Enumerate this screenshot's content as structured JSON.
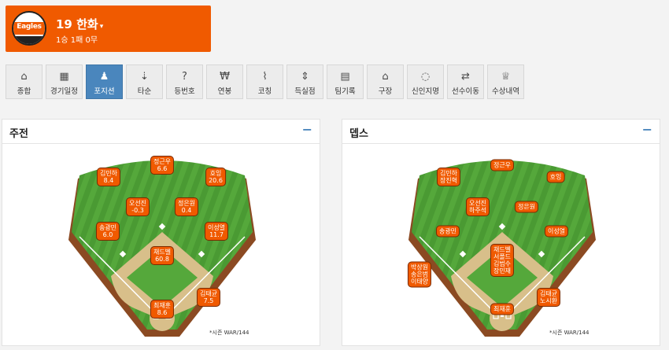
{
  "team": {
    "logo_text": "Eagles",
    "title": "19 한화",
    "record": "1승 1패 0무",
    "colors": {
      "accent": "#f05a00",
      "nav_active": "#4a86bd"
    }
  },
  "nav": {
    "items": [
      {
        "label": "종합",
        "icon": "home-icon",
        "glyph": "⌂"
      },
      {
        "label": "경기일정",
        "icon": "calendar-icon",
        "glyph": "▦"
      },
      {
        "label": "포지션",
        "icon": "player-icon",
        "glyph": "♟",
        "active": true
      },
      {
        "label": "타순",
        "icon": "batting-order-icon",
        "glyph": "⇣"
      },
      {
        "label": "등번호",
        "icon": "question-icon",
        "glyph": "?"
      },
      {
        "label": "연봉",
        "icon": "won-icon",
        "glyph": "₩"
      },
      {
        "label": "코칭",
        "icon": "chart-icon",
        "glyph": "⌇"
      },
      {
        "label": "득실점",
        "icon": "sort-icon",
        "glyph": "⇕"
      },
      {
        "label": "팀기록",
        "icon": "table-icon",
        "glyph": "▤"
      },
      {
        "label": "구장",
        "icon": "stadium-icon",
        "glyph": "⌂"
      },
      {
        "label": "신인지명",
        "icon": "spinner-icon",
        "glyph": "◌"
      },
      {
        "label": "선수이동",
        "icon": "exchange-icon",
        "glyph": "⇄"
      },
      {
        "label": "수상내역",
        "icon": "trophy-icon",
        "glyph": "♕"
      }
    ]
  },
  "panels": {
    "starters": {
      "title": "주전",
      "collapse": "−",
      "note": "*시즌 WAR/144",
      "positions": {
        "lf": {
          "name": "김민하",
          "value": "8.4"
        },
        "cf": {
          "name": "정근우",
          "value": "6.6"
        },
        "rf": {
          "name": "호잉",
          "value": "20.6"
        },
        "ss": {
          "name": "오선진",
          "value": "-0.3"
        },
        "2b": {
          "name": "정은원",
          "value": "0.4"
        },
        "3b": {
          "name": "송광민",
          "value": "6.0"
        },
        "1b": {
          "name": "이성열",
          "value": "11.7"
        },
        "p": {
          "name": "채드벨",
          "value": "60.8"
        },
        "dh": {
          "name": "김태균",
          "value": "7.5"
        },
        "c": {
          "name": "최재훈",
          "value": "8.6"
        }
      }
    },
    "depth": {
      "title": "뎁스",
      "collapse": "−",
      "note": "*시즌 WAR/144",
      "positions": {
        "lf": {
          "names": [
            "김민하",
            "장진혁"
          ]
        },
        "cf": {
          "names": [
            "정근우"
          ]
        },
        "rf": {
          "names": [
            "호잉"
          ]
        },
        "ss": {
          "names": [
            "오선진",
            "하주석"
          ]
        },
        "2b": {
          "names": [
            "정은원"
          ]
        },
        "3b": {
          "names": [
            "송광민"
          ]
        },
        "1b": {
          "names": [
            "이성열"
          ]
        },
        "p": {
          "names": [
            "채드벨",
            "서폴드",
            "김범수",
            "장민재"
          ]
        },
        "bench": {
          "names": [
            "박상원",
            "송은범",
            "이태양"
          ]
        },
        "dh": {
          "names": [
            "김태균",
            "노시환"
          ]
        },
        "c": {
          "names": [
            "최재훈"
          ]
        }
      }
    }
  }
}
